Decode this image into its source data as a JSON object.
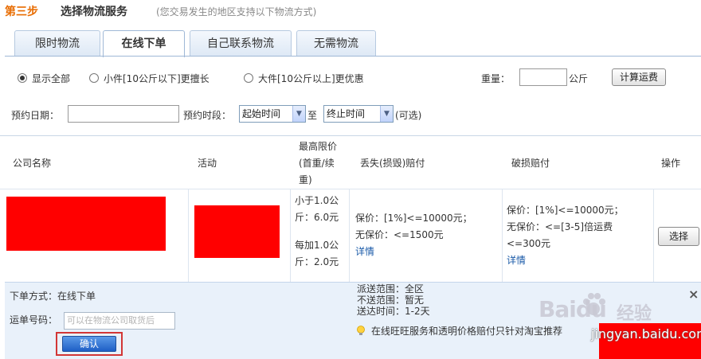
{
  "header": {
    "step": "第三步",
    "title": "选择物流服务",
    "note": "(您交易发生的地区支持以下物流方式)"
  },
  "tabs": [
    {
      "label": "限时物流",
      "active": false
    },
    {
      "label": "在线下单",
      "active": true
    },
    {
      "label": "自己联系物流",
      "active": false
    },
    {
      "label": "无需物流",
      "active": false
    }
  ],
  "filters": {
    "options": [
      {
        "label": "显示全部",
        "checked": true
      },
      {
        "label": "小件[10公斤以下]更擅长",
        "checked": false
      },
      {
        "label": "大件[10公斤以上]更优惠",
        "checked": false
      }
    ],
    "weight_label": "重量：",
    "weight_value": "",
    "weight_unit": "公斤",
    "calc_button": "计算运费"
  },
  "schedule": {
    "date_label": "预约日期：",
    "date_value": "",
    "period_label": "预约时段：",
    "start_select": "起始时间",
    "to_label": "至",
    "end_select": "终止时间",
    "optional": "(可选)"
  },
  "table": {
    "headers": {
      "company": "公司名称",
      "activity": "活动",
      "price_line1": "最高限价",
      "price_line2": "(首重/续",
      "price_line3": "重)",
      "loss": "丢失(损毁)赔付",
      "damage": "破损赔付",
      "action": "操作"
    },
    "row": {
      "price_lines": [
        "小于1.0公",
        "斤：6.0元",
        "",
        "每加1.0公",
        "斤：2.0元"
      ],
      "loss_lines": [
        "保价：[1%]<=10000元；",
        "无保价：<=1500元"
      ],
      "loss_link": "详情",
      "damage_lines": [
        "保价：[1%]<=10000元；",
        "无保价：<=[3-5]倍运费",
        "<=300元"
      ],
      "damage_link": "详情",
      "select_button": "选择"
    }
  },
  "detail": {
    "order_method": "下单方式：在线下单",
    "waybill_label": "运单号码：",
    "waybill_placeholder": "可以在物流公司取货后",
    "confirm_button": "确认",
    "range": "派送范围：全区",
    "no_range": "不送范围：暂无",
    "time": "送达时间：1-2天",
    "tip": "在线旺旺服务和透明价格赔付只针对淘宝推荐",
    "close": "×"
  },
  "watermark": {
    "brand": "Baidu",
    "jingyan": "经验",
    "url": "jingyan.baidu.com"
  },
  "colors": {
    "step_orange": "#e86c00",
    "redact_red": "#ff0000",
    "link_blue": "#1a5aa8",
    "panel_blue": "#e9f1fa",
    "confirm_blue": "#1e5fc6"
  }
}
